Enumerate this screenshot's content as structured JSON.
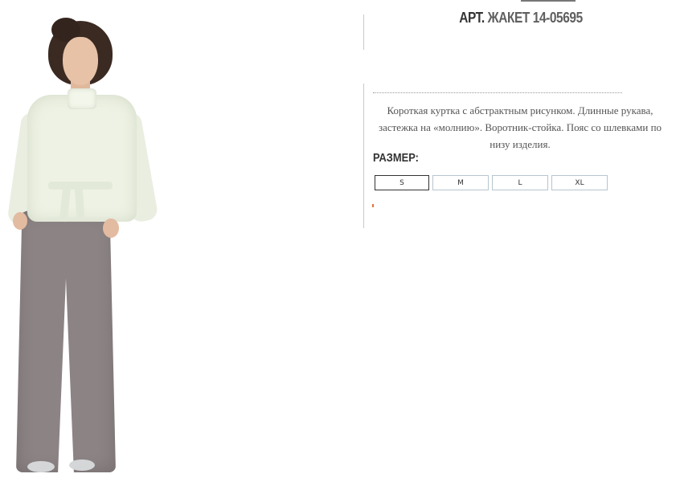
{
  "product": {
    "title_prefix": "АРТ.",
    "title_name": "ЖАКЕТ 14-05695",
    "description": "Короткая куртка с абстрактным рисунком. Длинные рукава, застежка на «молнию». Воротник-стойка. Пояс со шлевками по низу изделия.",
    "size_label": "РАЗМЕР:",
    "sizes": [
      "S",
      "M",
      "L",
      "XL"
    ],
    "selected_size": "S"
  },
  "photo": {
    "colors": {
      "jacket": "#eef2e4",
      "pants": "#8c8384",
      "hair": "#3b2a22"
    }
  },
  "colors": {
    "accent_mark": "#e6703a",
    "size_border": "#b7c5cf"
  }
}
